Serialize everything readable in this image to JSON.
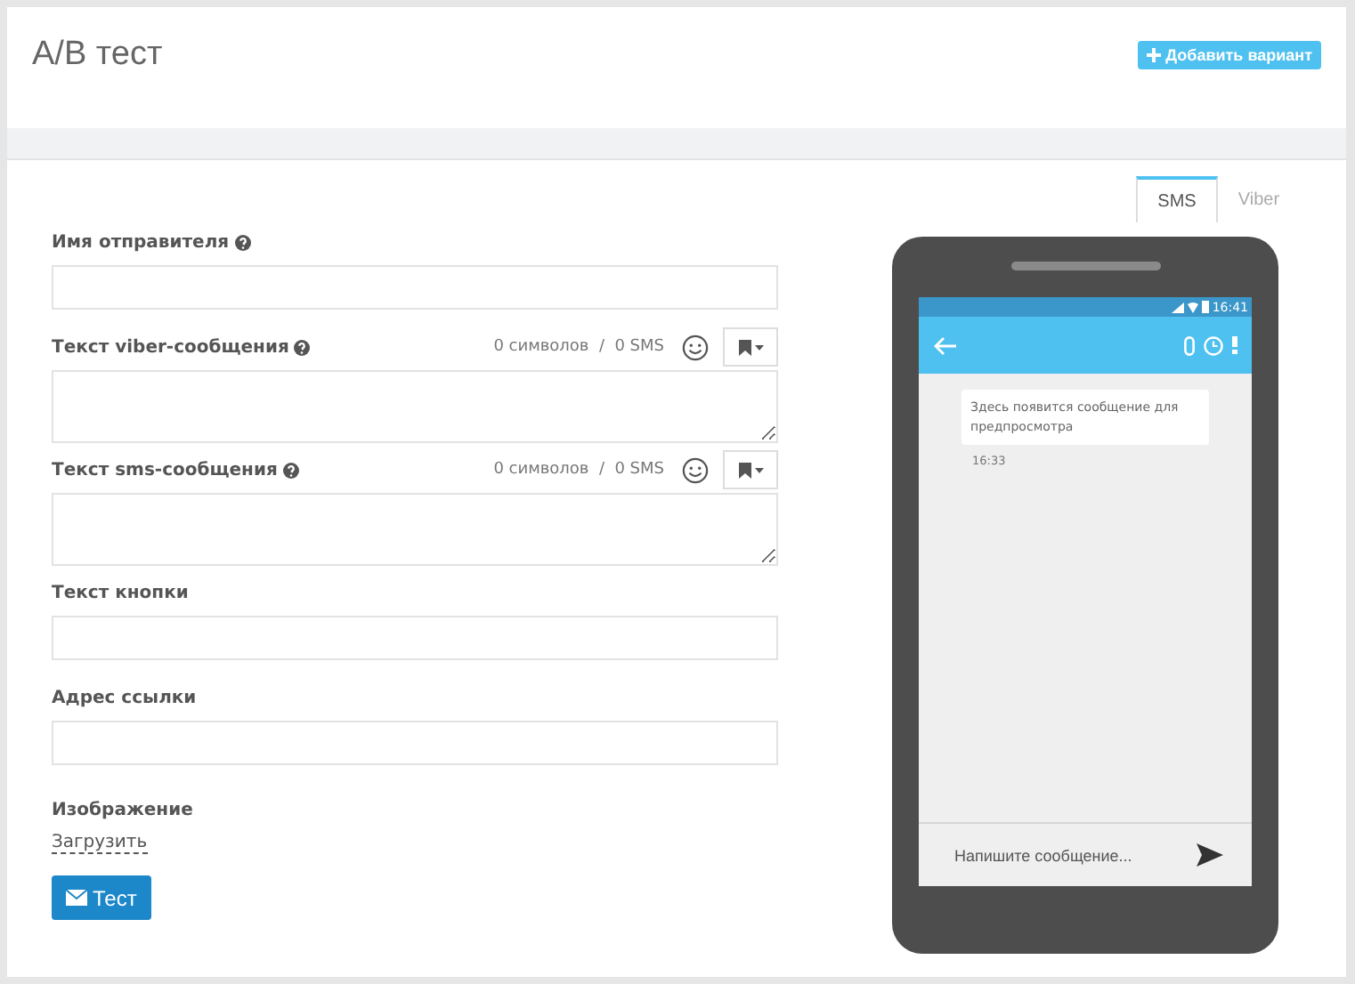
{
  "header": {
    "title": "A/B тест",
    "add_button": "Добавить вариант"
  },
  "form": {
    "fields": [
      {
        "kind": "input",
        "label": "Имя отправителя",
        "help": true
      },
      {
        "kind": "textarea",
        "label": "Текст viber-сообщения",
        "help": true,
        "counter": "0 символов  /  0 SMS"
      },
      {
        "kind": "textarea",
        "label": "Текст sms-сообщения",
        "help": true,
        "counter": "0 символов  /  0 SMS"
      },
      {
        "kind": "input",
        "label": "Текст кнопки",
        "help": false
      },
      {
        "kind": "input",
        "label": "Адрес ссылки",
        "help": false
      }
    ],
    "image": {
      "label": "Изображение",
      "upload_link": "Загрузить"
    },
    "test_button": "Тест"
  },
  "preview": {
    "tabs": [
      {
        "label": "SMS",
        "selected": true
      },
      {
        "label": "Viber",
        "selected": false
      }
    ],
    "status_time": "16:41",
    "message": {
      "text": "Здесь появится сообщение для предпросмотра",
      "time": "16:33"
    },
    "compose": {
      "placeholder": "Напишите сообщение..."
    }
  }
}
